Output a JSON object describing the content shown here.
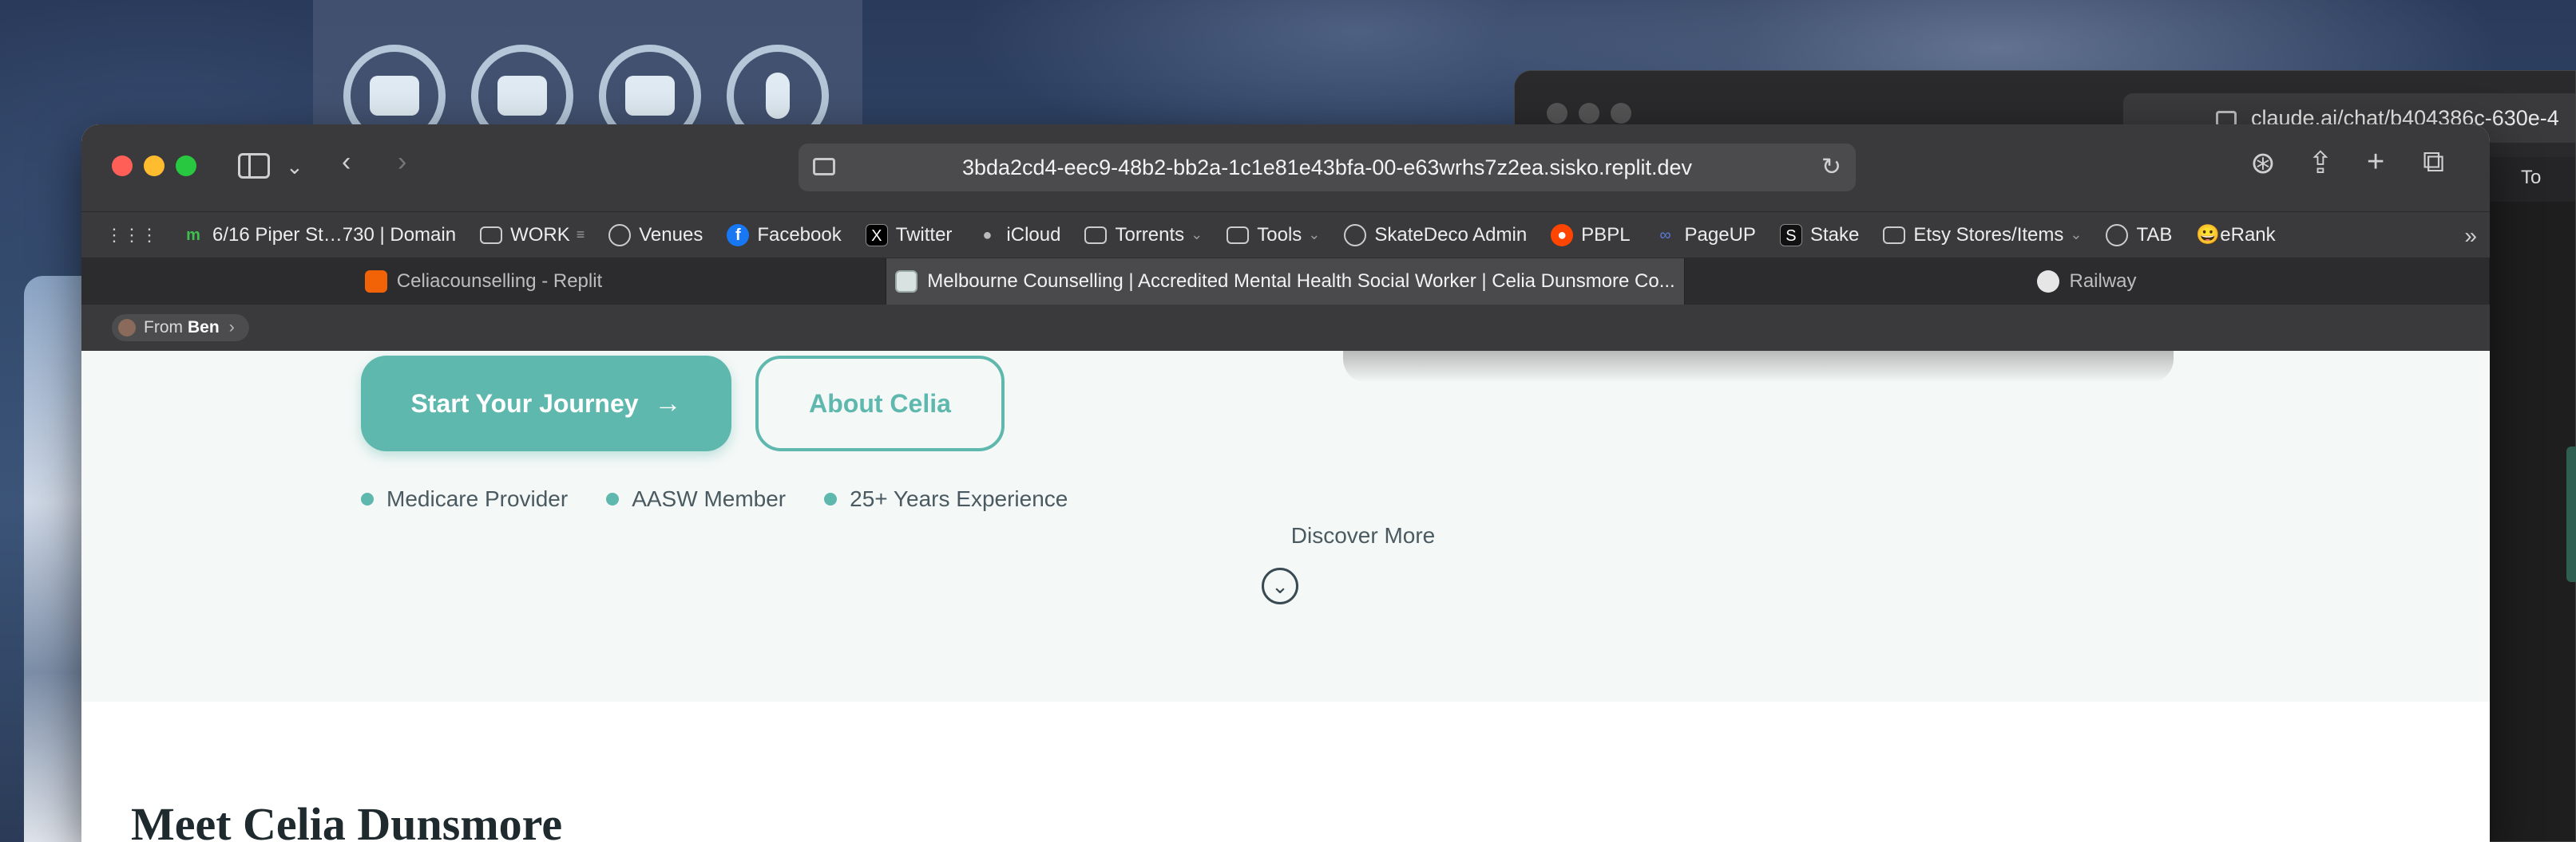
{
  "background_window": {
    "url": "claude.ai/chat/b404386c-630e-4",
    "bookmark_partial": "To"
  },
  "toolbar": {
    "url": "3bda2cd4-eec9-48b2-bb2a-1c1e81e43bfa-00-e63wrhs7z2ea.sisko.replit.dev"
  },
  "bookmarks": [
    {
      "label": "6/16 Piper St…730 | Domain",
      "icon": "domain-icon",
      "color": "#3fbf4f"
    },
    {
      "label": "WORK",
      "icon": "folder-icon",
      "suffix": "≡"
    },
    {
      "label": "Venues",
      "icon": "globe-icon"
    },
    {
      "label": "Facebook",
      "icon": "facebook-icon",
      "color": "#1877f2"
    },
    {
      "label": "Twitter",
      "icon": "twitter-x-icon"
    },
    {
      "label": "iCloud",
      "icon": "apple-icon"
    },
    {
      "label": "Torrents",
      "icon": "folder-icon",
      "chevron": true
    },
    {
      "label": "Tools",
      "icon": "folder-icon",
      "chevron": true
    },
    {
      "label": "SkateDeco Admin",
      "icon": "globe-icon"
    },
    {
      "label": "PBPL",
      "icon": "reddit-icon",
      "color": "#ff4500"
    },
    {
      "label": "PageUP",
      "icon": "pageup-icon"
    },
    {
      "label": "Stake",
      "icon": "stake-icon"
    },
    {
      "label": "Etsy Stores/Items",
      "icon": "folder-icon",
      "chevron": true
    },
    {
      "label": "TAB",
      "icon": "globe-icon"
    },
    {
      "label": "😀eRank",
      "icon": ""
    }
  ],
  "tabs": [
    {
      "label": "Celiacounselling - Replit",
      "icon": "replit-icon",
      "color": "#f26207"
    },
    {
      "label": "Melbourne Counselling | Accredited Mental Health Social Worker | Celia Dunsmore Co...",
      "icon": "cdc-icon",
      "color": "#d8e2e0",
      "active": true
    },
    {
      "label": "Railway",
      "icon": "railway-icon",
      "color": "#e6e6e6"
    }
  ],
  "from_bar": {
    "prefix": "From",
    "name": "Ben"
  },
  "page": {
    "primary_button": "Start Your Journey",
    "primary_arrow": "→",
    "secondary_button": "About Celia",
    "badges": [
      "Medicare Provider",
      "AASW Member",
      "25+ Years Experience"
    ],
    "discover": "Discover More",
    "section_title": "Meet Celia Dunsmore"
  },
  "colors": {
    "accent": "#5fb8ad",
    "hero_bg": "#f4f8f7",
    "toolbar": "#3a3a3c"
  }
}
